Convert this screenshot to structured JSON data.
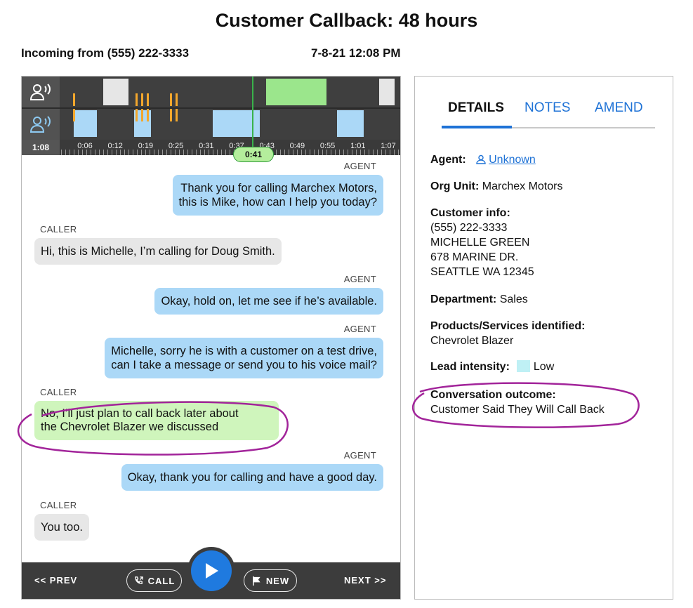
{
  "title": "Customer Callback: 48 hours",
  "incoming": "Incoming from (555) 222-3333",
  "datetime": "7-8-21 12:08 PM",
  "timeline": {
    "total_time": "1:08",
    "ticks": [
      "0:06",
      "0:12",
      "0:19",
      "0:25",
      "0:31",
      "0:37",
      "0:43",
      "0:49",
      "0:55",
      "1:01",
      "1:07"
    ],
    "playhead": "0:41",
    "colors": {
      "agent_speech": "#e6e6e6",
      "agent_highlight": "#9be68c",
      "caller_speech": "#abd8f7",
      "marker": "#f3a72c"
    }
  },
  "transcript": [
    {
      "speaker": "AGENT",
      "lines": [
        "Thank you for calling Marchex Motors,",
        "this is Mike, how can I help you today?"
      ]
    },
    {
      "speaker": "CALLER",
      "lines": [
        "Hi, this is Michelle, I’m calling for Doug Smith."
      ]
    },
    {
      "speaker": "AGENT",
      "lines": [
        "Okay, hold on, let me see if he’s available."
      ]
    },
    {
      "speaker": "AGENT",
      "lines": [
        "Michelle, sorry he is with a customer on a test drive,",
        "can I take a message or send you to his voice mail?"
      ]
    },
    {
      "speaker": "CALLER",
      "lines": [
        "No, I’ll just plan to call back later about",
        "the Chevrolet Blazer we discussed"
      ]
    },
    {
      "speaker": "AGENT",
      "lines": [
        "Okay, thank you for calling and have a good day."
      ]
    },
    {
      "speaker": "CALLER",
      "lines": [
        "You too."
      ]
    }
  ],
  "controls": {
    "prev": "<< PREV",
    "call": "CALL",
    "new": "NEW",
    "next": "NEXT >>"
  },
  "tabs": [
    {
      "label": "DETAILS",
      "active": true
    },
    {
      "label": "NOTES",
      "active": false
    },
    {
      "label": "AMEND",
      "active": false
    }
  ],
  "details": {
    "agent_label": "Agent:",
    "agent_value": "Unknown",
    "org_label": "Org Unit:",
    "org_value": "Marchex Motors",
    "customer_label": "Customer info:",
    "customer_phone": "(555) 222-3333",
    "customer_name": "MICHELLE GREEN",
    "customer_street": "678 MARINE DR.",
    "customer_city": "SEATTLE WA 12345",
    "department_label": "Department:",
    "department_value": "Sales",
    "products_label": "Products/Services identified:",
    "products_value": "Chevrolet Blazer",
    "lead_label": "Lead intensity:",
    "lead_value": "Low",
    "lead_color": "#bff0f5",
    "outcome_label": "Conversation outcome:",
    "outcome_value": "Customer Said They Will Call Back"
  },
  "colors": {
    "accent": "#1e72d6",
    "annotation": "#a2249a",
    "play": "#1f7adf"
  }
}
